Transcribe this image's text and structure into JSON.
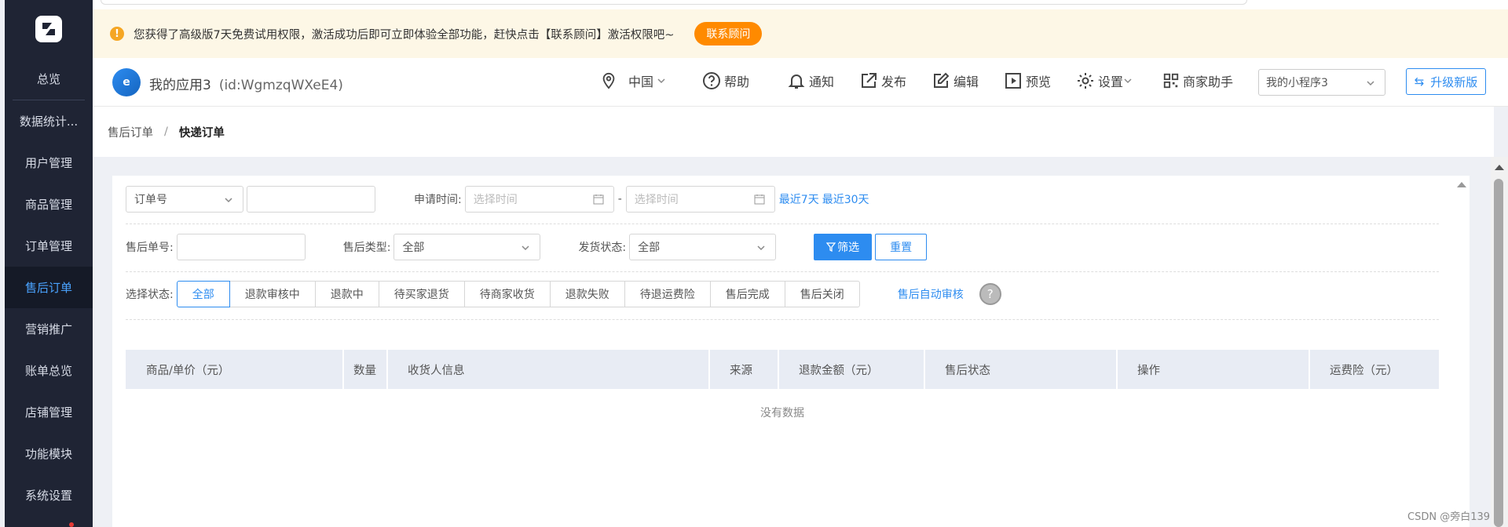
{
  "sidebar": {
    "items": [
      {
        "label": "总览"
      },
      {
        "label": "数据统计..."
      },
      {
        "label": "用户管理"
      },
      {
        "label": "商品管理"
      },
      {
        "label": "订单管理"
      },
      {
        "label": "售后订单"
      },
      {
        "label": "营销推广"
      },
      {
        "label": "账单总览"
      },
      {
        "label": "店铺管理"
      },
      {
        "label": "功能模块"
      },
      {
        "label": "系统设置"
      }
    ],
    "active_index": 5
  },
  "notice": {
    "text": "您获得了高级版7天免费试用权限，激活成功后即可立即体验全部功能，赶快点击【联系顾问】激活权限吧~",
    "button": "联系顾问"
  },
  "header": {
    "app_name": "我的应用3",
    "app_id": "(id:WgmzqWXeE4)",
    "region": "中国",
    "tools": {
      "help": "帮助",
      "notify": "通知",
      "publish": "发布",
      "edit": "编辑",
      "preview": "预览",
      "settings": "设置",
      "merchant": "商家助手"
    },
    "mini_program": "我的小程序3",
    "upgrade": "升级新版"
  },
  "breadcrumb": {
    "parent": "售后订单",
    "current": "快递订单"
  },
  "filters": {
    "order_type": "订单号",
    "apply_time_label": "申请时间:",
    "start_placeholder": "选择时间",
    "end_placeholder": "选择时间",
    "range_sep": "-",
    "last7": "最近7天",
    "last30": "最近30天",
    "aftersale_no_label": "售后单号:",
    "aftersale_type_label": "售后类型:",
    "aftersale_type_value": "全部",
    "ship_status_label": "发货状态:",
    "ship_status_value": "全部",
    "filter_button": "筛选",
    "reset_button": "重置",
    "status_label": "选择状态:",
    "status_tabs": [
      "全部",
      "退款审核中",
      "退款中",
      "待买家退货",
      "待商家收货",
      "退款失败",
      "待退运费险",
      "售后完成",
      "售后关闭"
    ],
    "auto_review": "售后自动审核",
    "help_mark": "?"
  },
  "table": {
    "columns": [
      "商品/单价（元）",
      "数量",
      "收货人信息",
      "来源",
      "退款金额（元）",
      "售后状态",
      "操作",
      "运费险（元）"
    ],
    "empty_text": "没有数据"
  },
  "watermark": "CSDN @旁白139"
}
